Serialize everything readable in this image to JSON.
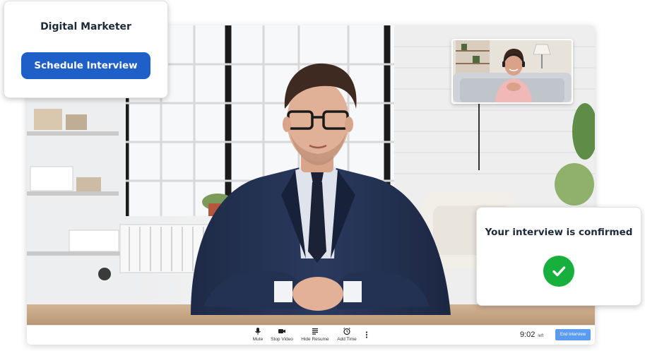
{
  "job_card": {
    "title": "Digital Marketer",
    "schedule_label": "Schedule Interview"
  },
  "confirmation": {
    "message": "Your interview is confirmed",
    "icon": "check-circle-icon",
    "icon_color": "#17b03d"
  },
  "controls": {
    "items": [
      {
        "label": "Mute",
        "icon": "microphone-icon"
      },
      {
        "label": "Stop Video",
        "icon": "video-camera-icon"
      },
      {
        "label": "Hide Resume",
        "icon": "document-lines-icon"
      },
      {
        "label": "Add Time",
        "icon": "alarm-clock-icon"
      }
    ],
    "more_icon": "more-vertical-icon",
    "time_value": "9:02",
    "time_suffix": "left",
    "end_label": "End Interview"
  },
  "colors": {
    "primary_button": "#1e5fc8",
    "end_button": "#5b9bf0",
    "success": "#17b03d",
    "heading_text": "#1e2a3a"
  }
}
